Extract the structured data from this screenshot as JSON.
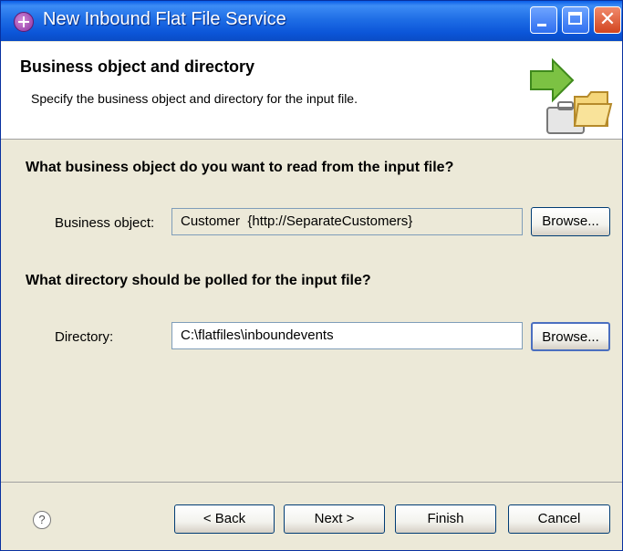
{
  "window": {
    "title": "New Inbound Flat File Service"
  },
  "header": {
    "title": "Business object and directory",
    "description": "Specify the business object and directory for the input file."
  },
  "business_object": {
    "question": "What business object do you want to read from the input file?",
    "label": "Business object:",
    "value": "Customer  {http://SeparateCustomers}",
    "browse_label": "Browse..."
  },
  "directory": {
    "question": "What directory should be polled for the input file?",
    "label": "Directory:",
    "value": "C:\\flatfiles\\inboundevents",
    "browse_label": "Browse..."
  },
  "footer": {
    "help_symbol": "?",
    "back_label": "< Back",
    "next_label": "Next >",
    "finish_label": "Finish",
    "cancel_label": "Cancel"
  },
  "icons": {
    "window_icon": "app-icon",
    "minimize": "minimize-icon",
    "maximize": "maximize-icon",
    "close": "close-icon",
    "banner": "folder-arrow-icon",
    "help": "help-icon"
  },
  "colors": {
    "titlebar": "#1f6ee6",
    "window_bg": "#ece9d8",
    "close_button": "#d2451f"
  }
}
